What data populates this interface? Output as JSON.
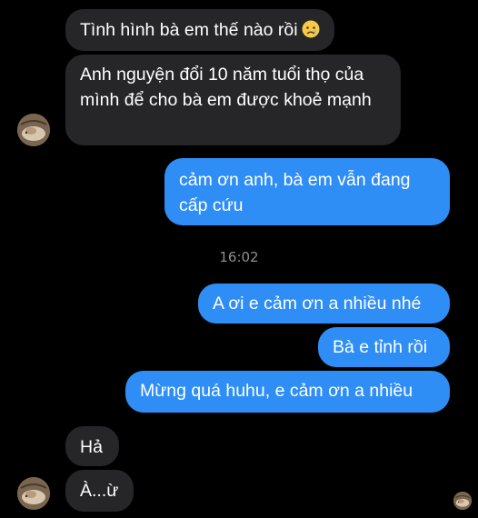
{
  "messages": {
    "m1": {
      "text": "Tình hình bà em thế nào rồi",
      "emoji": "crying-face-icon"
    },
    "m2": {
      "text": "Anh nguyện đổi 10 năm tuổi thọ của mình để cho bà em được khoẻ mạnh"
    },
    "m3": {
      "text": "cảm ơn anh, bà em vẫn đang cấp cứu"
    },
    "timestamp": "16:02",
    "m4": {
      "text": "A ơi e cảm ơn a nhiều nhé"
    },
    "m5": {
      "text": "Bà e tỉnh rồi"
    },
    "m6": {
      "text": "Mừng quá huhu, e cảm ơn a nhiều"
    },
    "m7": {
      "text": "Hả"
    },
    "m8": {
      "text": "À...ừ"
    }
  },
  "colors": {
    "background": "#000000",
    "received_bubble": "#262629",
    "sent_bubble": "#2f8ef5",
    "timestamp": "#8e8e93"
  },
  "avatar": {
    "icon": "cat-avatar-icon"
  }
}
